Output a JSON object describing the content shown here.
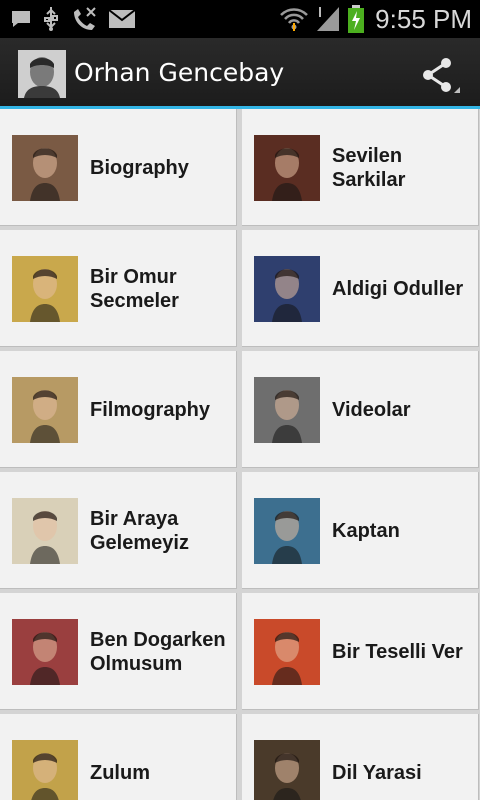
{
  "status_bar": {
    "time": "9:55 PM",
    "icons": [
      "message-icon",
      "usb-icon",
      "missed-call-icon",
      "mail-icon",
      "wifi-icon",
      "signal-icon",
      "battery-charging-icon"
    ]
  },
  "action_bar": {
    "title": "Orhan Gencebay",
    "share_icon": "share-icon"
  },
  "tiles": [
    {
      "label": "Biography",
      "thumb_bg": "#7a5a44"
    },
    {
      "label": "Sevilen\nSarkilar",
      "thumb_bg": "#5a2d22"
    },
    {
      "label": "Bir Omur\nSecmeler",
      "thumb_bg": "#c9a84c"
    },
    {
      "label": "Aldigi Oduller",
      "thumb_bg": "#2f3f6e"
    },
    {
      "label": "Filmography",
      "thumb_bg": "#b79a64"
    },
    {
      "label": "Videolar",
      "thumb_bg": "#6e6e6e"
    },
    {
      "label": "Bir Araya\nGelemeyiz",
      "thumb_bg": "#d9d0b8"
    },
    {
      "label": "Kaptan",
      "thumb_bg": "#3d6f8f"
    },
    {
      "label": "Ben Dogarken\nOlmusum",
      "thumb_bg": "#9a3f3f"
    },
    {
      "label": "Bir Teselli Ver",
      "thumb_bg": "#c94a2a"
    },
    {
      "label": "Zulum",
      "thumb_bg": "#c2a24a"
    },
    {
      "label": "Dil Yarasi",
      "thumb_bg": "#4a3a2a"
    }
  ]
}
